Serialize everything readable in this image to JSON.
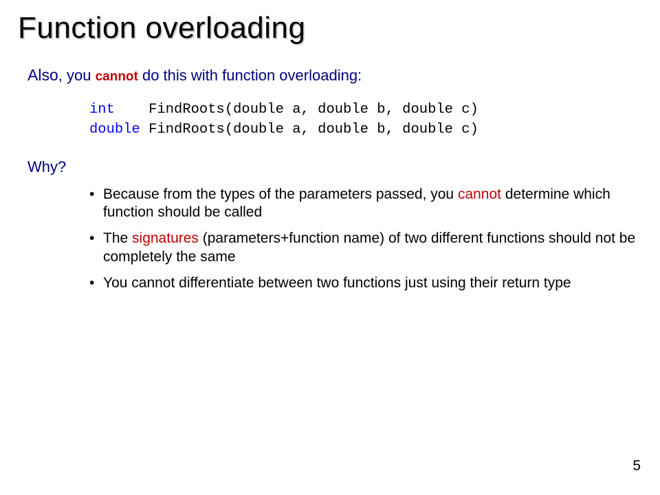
{
  "title": "Function overloading",
  "lead": {
    "prefix": "Also",
    "sep": ", ",
    "part1": "you ",
    "cannot": "cannot",
    "part2": " do this with function overloading:"
  },
  "code": {
    "kw1": "int",
    "line1_rest": "    FindRoots(double a, double b, double c)",
    "kw2": "double",
    "line2_rest": " FindRoots(double a, double b, double c)"
  },
  "why": "Why?",
  "bullets": [
    {
      "pre": "Because from the types of the parameters passed, you ",
      "red": "cannot",
      "post": " determine which function should be called"
    },
    {
      "pre": "The ",
      "red": "signatures",
      "post": " (parameters+function name) of two different functions should not be completely the same"
    },
    {
      "pre": "You cannot differentiate between two functions just using their return type",
      "red": "",
      "post": ""
    }
  ],
  "page_number": "5"
}
